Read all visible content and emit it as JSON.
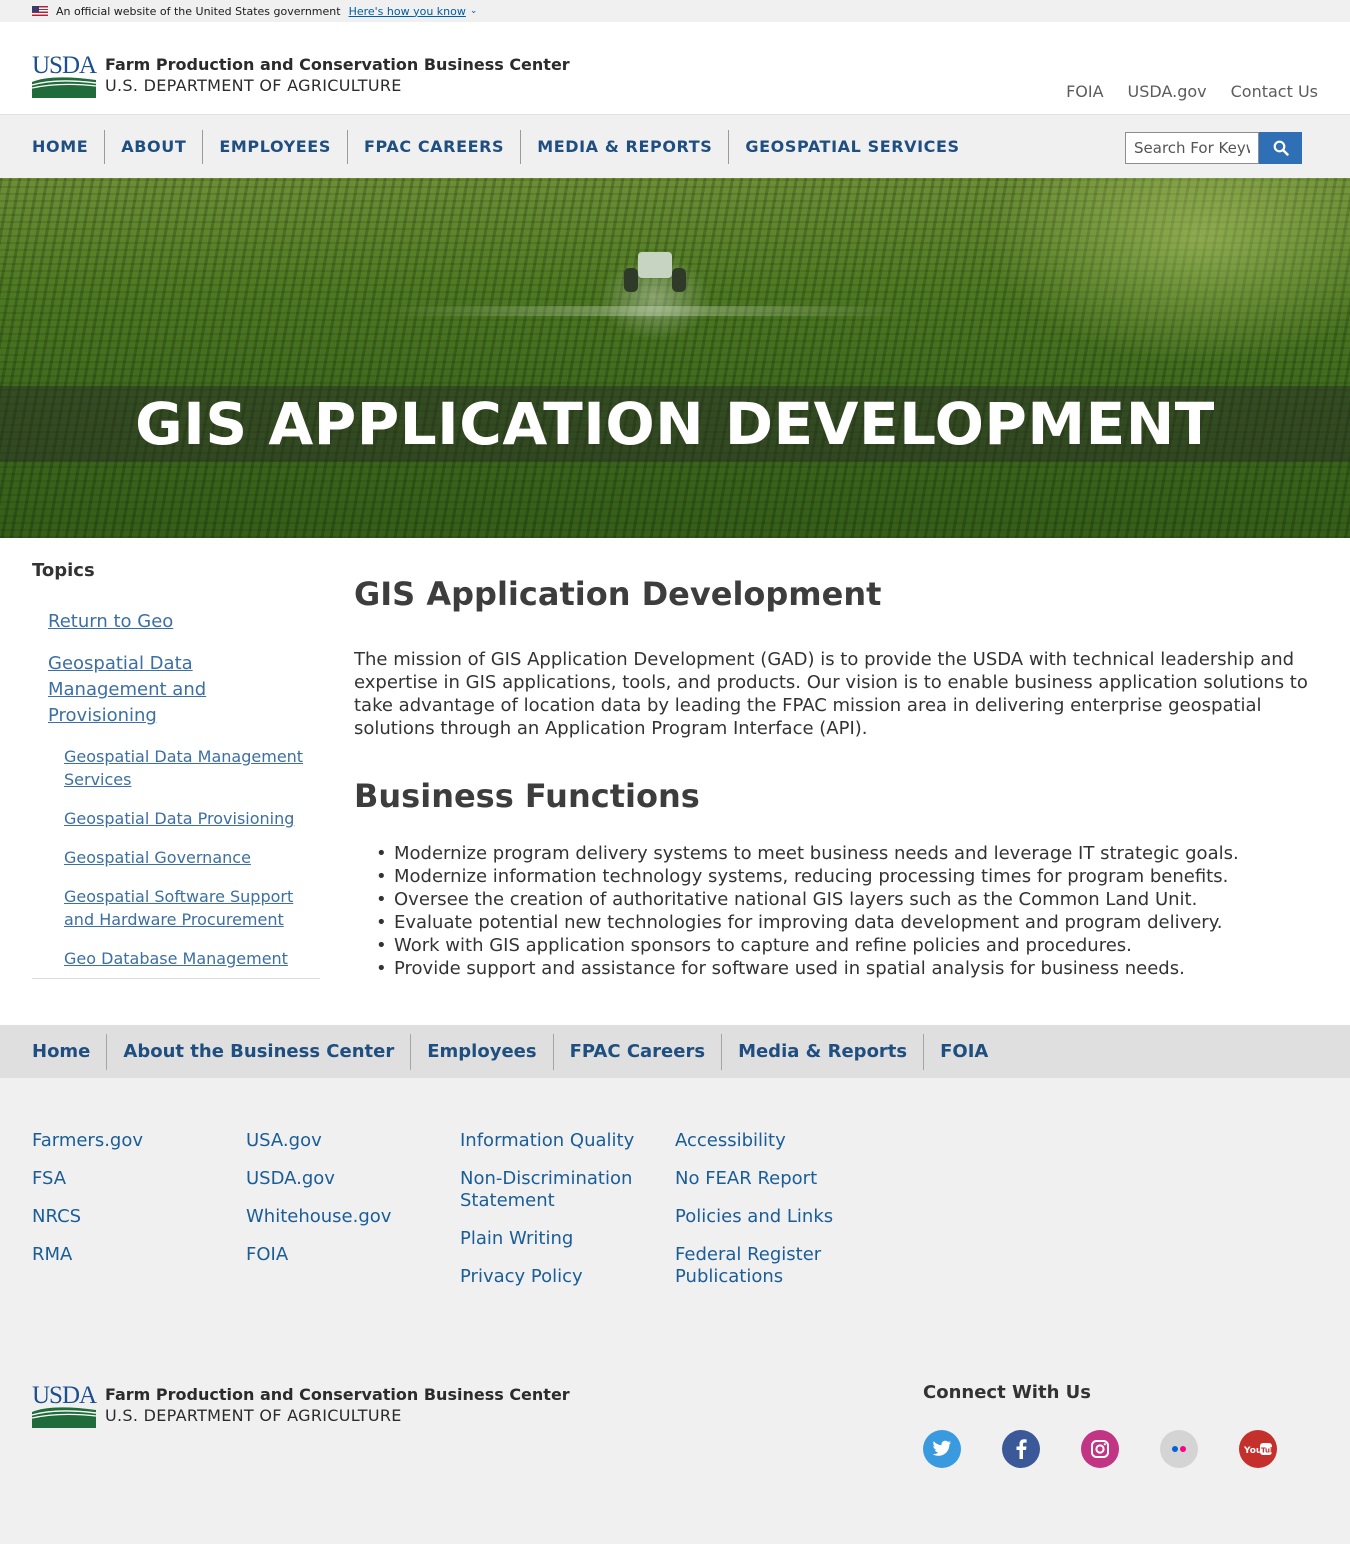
{
  "gov_banner": {
    "text": "An official website of the United States government",
    "how_link": "Here's how you know",
    "chevron": "⌄"
  },
  "header": {
    "logo_usda": "USDA",
    "title": "Farm Production and Conservation Business Center",
    "subtitle": "U.S. DEPARTMENT OF AGRICULTURE",
    "util_links": [
      "FOIA",
      "USDA.gov",
      "Contact Us"
    ]
  },
  "nav": {
    "items": [
      "HOME",
      "ABOUT",
      "EMPLOYEES",
      "FPAC CAREERS",
      "MEDIA & REPORTS",
      "GEOSPATIAL SERVICES"
    ],
    "search_placeholder": "Search For Keywords"
  },
  "hero": {
    "title": "GIS APPLICATION DEVELOPMENT"
  },
  "sidebar": {
    "heading": "Topics",
    "items": [
      "Return to Geo",
      "Geospatial Data Management and Provisioning"
    ],
    "sub_items": [
      "Geospatial Data Management Services",
      "Geospatial Data Provisioning",
      "Geospatial Governance",
      "Geospatial Software Support and Hardware Procurement",
      "Geo Database Management"
    ]
  },
  "main": {
    "title": "GIS Application Development",
    "mission": "The mission of GIS Application Development (GAD) is to provide the USDA with technical leadership and expertise in GIS applications, tools, and products. Our vision is to enable business application solutions to take advantage of location data by leading the FPAC mission area in delivering enterprise geospatial solutions through an Application Program Interface (API).",
    "functions_heading": "Business Functions",
    "functions": [
      "Modernize program delivery systems to meet business needs and leverage IT strategic goals.",
      "Modernize information technology systems, reducing processing times for program benefits.",
      "Oversee the creation of authoritative national GIS layers such as the Common Land Unit.",
      "Evaluate potential new technologies for improving data development and program delivery.",
      "Work with GIS application sponsors to capture and refine policies and procedures.",
      "Provide support and assistance for software used in spatial analysis for business needs."
    ]
  },
  "footer_nav": [
    "Home",
    "About the Business Center",
    "Employees",
    "FPAC Careers",
    "Media & Reports",
    "FOIA"
  ],
  "footer_links": {
    "col1": [
      "Farmers.gov",
      "FSA",
      "NRCS",
      "RMA"
    ],
    "col2": [
      "USA.gov",
      "USDA.gov",
      "Whitehouse.gov",
      "FOIA"
    ],
    "col3": [
      "Information Quality",
      "Non-Discrimination Statement",
      "Plain Writing",
      "Privacy Policy"
    ],
    "col4": [
      "Accessibility",
      "No FEAR Report",
      "Policies and Links",
      "Federal Register Publications"
    ]
  },
  "connect": {
    "heading": "Connect With Us",
    "socials": [
      {
        "icon": "twitter-icon",
        "color": "#3a9ae0"
      },
      {
        "icon": "facebook-icon",
        "color": "#3b5998"
      },
      {
        "icon": "instagram-icon",
        "color": "#c13584"
      },
      {
        "icon": "flickr-icon",
        "color": "#d4d4d4"
      },
      {
        "icon": "youtube-icon",
        "color": "#c4302b"
      }
    ]
  },
  "colors": {
    "nav_text": "#1f4e80",
    "link": "#3c6fa3",
    "search_button": "#2f6fb6",
    "usda_green": "#1f6b3a",
    "usda_blue": "#1b4f8f"
  }
}
